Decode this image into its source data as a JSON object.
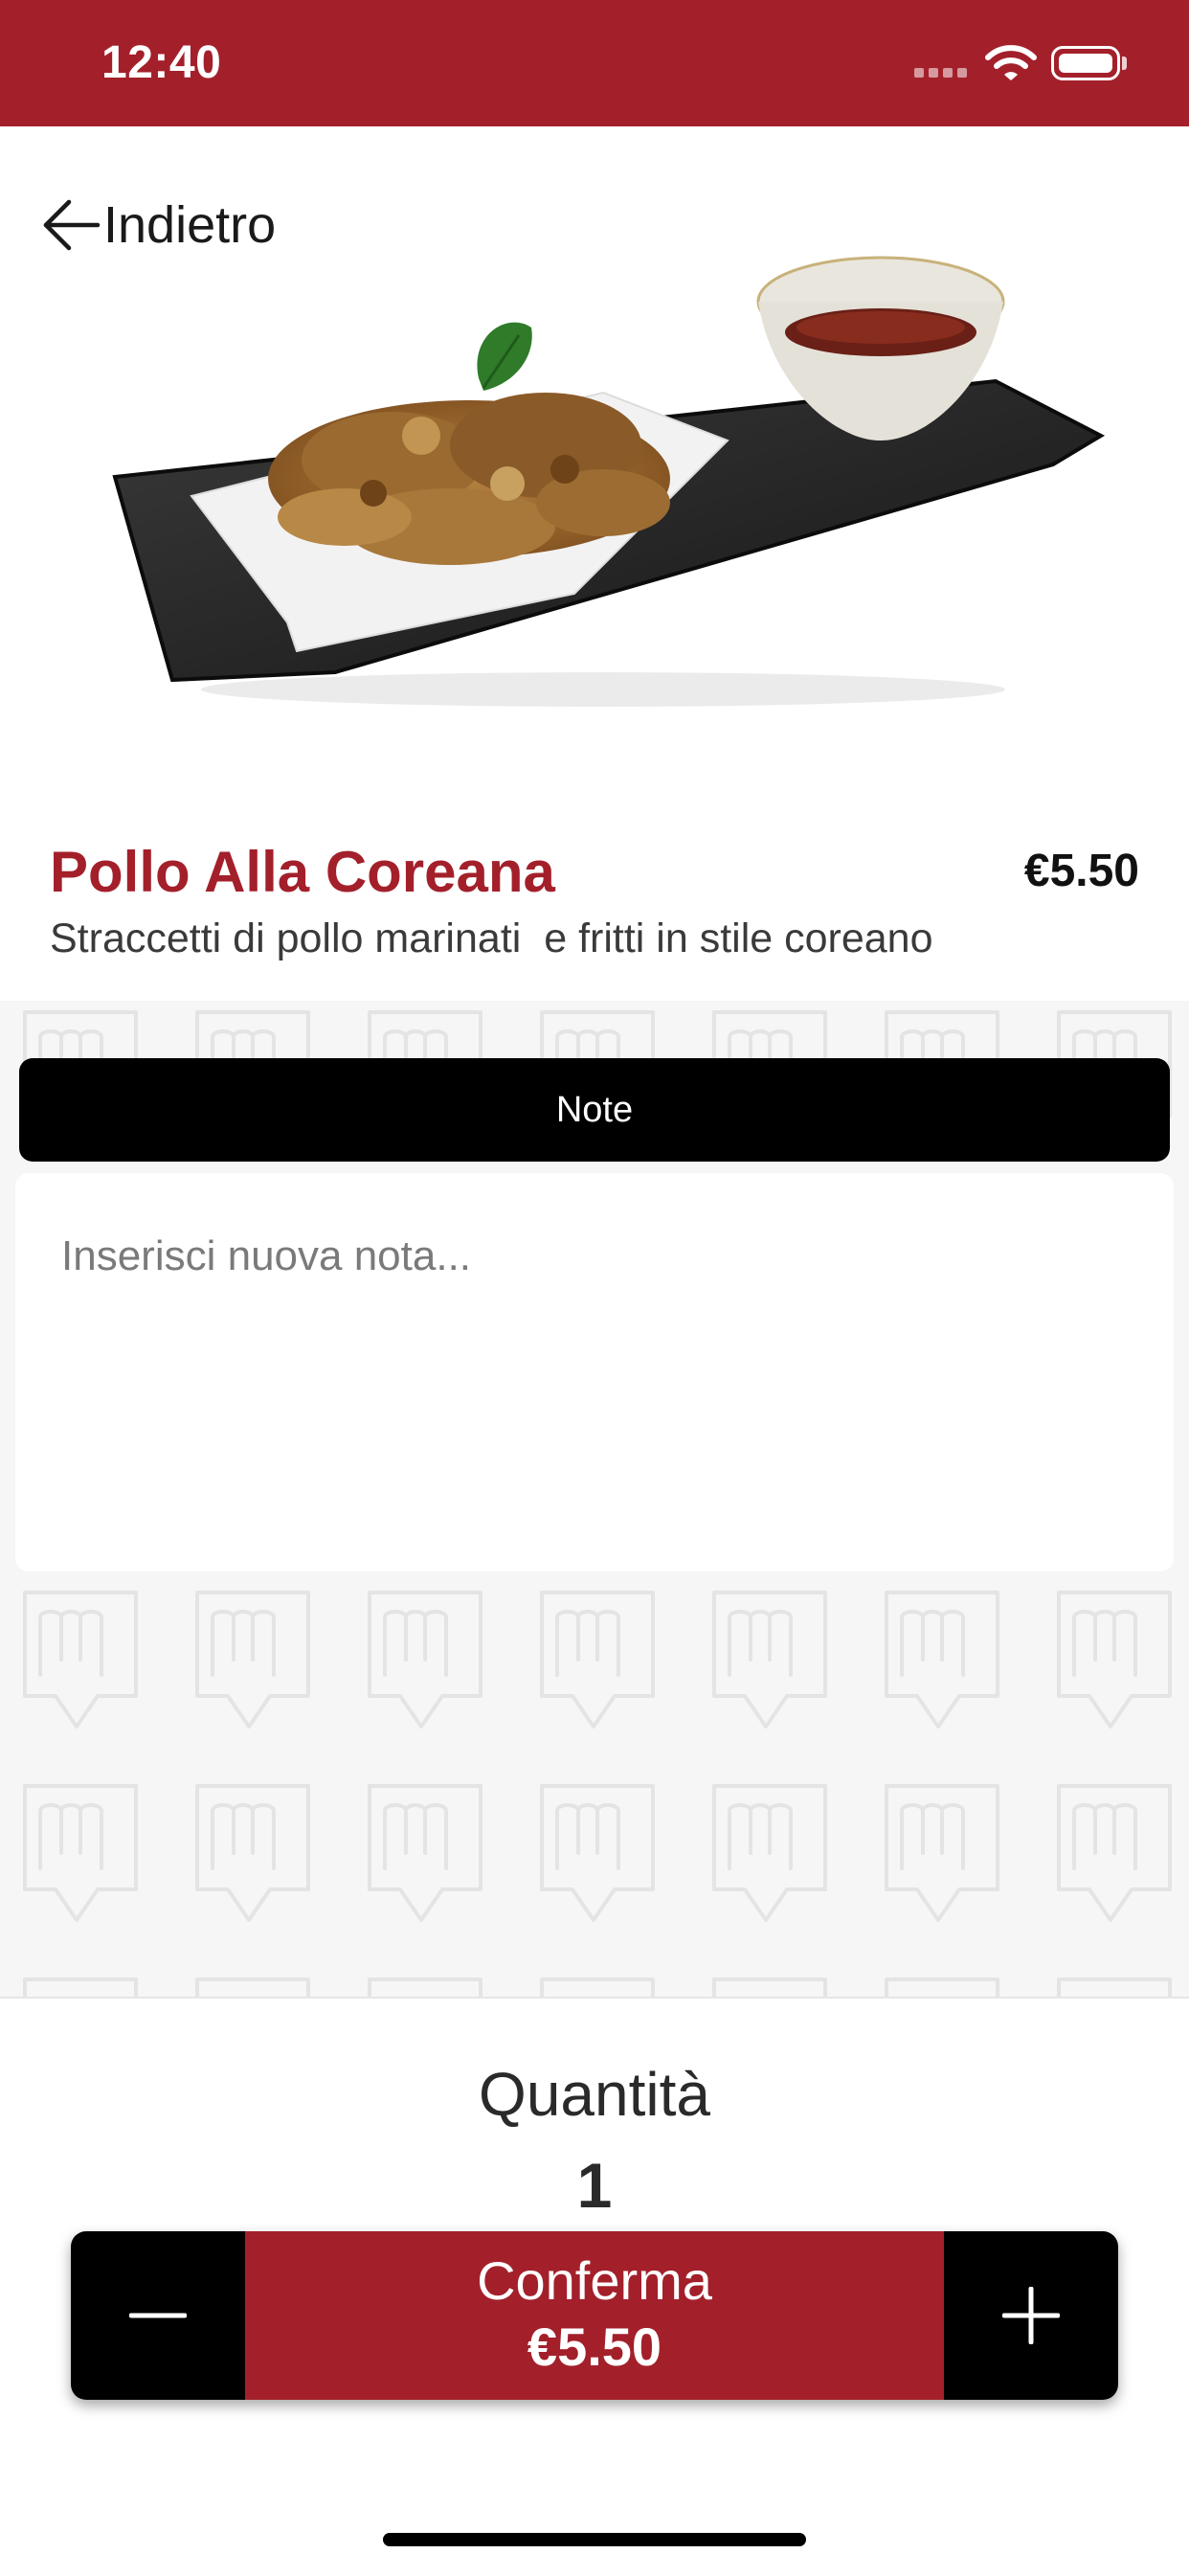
{
  "status_bar": {
    "time": "12:40"
  },
  "nav": {
    "back_label": "Indietro"
  },
  "product": {
    "name": "Pollo Alla Coreana",
    "price": "€5.50",
    "description": "Straccetti di pollo marinati  e fritti in stile coreano"
  },
  "notes": {
    "header_label": "Note",
    "input_placeholder": "Inserisci nuova nota...",
    "input_value": ""
  },
  "quantity": {
    "label": "Quantità",
    "value": "1"
  },
  "confirm": {
    "label": "Conferma",
    "price": "€5.50"
  },
  "colors": {
    "brand": "#a3202b",
    "dark": "#000000",
    "pattern_bg": "#f6f6f6"
  },
  "icons": {
    "back": "arrow-left-icon",
    "minus": "minus-icon",
    "plus": "plus-icon",
    "wifi": "wifi-icon",
    "battery": "battery-icon"
  }
}
